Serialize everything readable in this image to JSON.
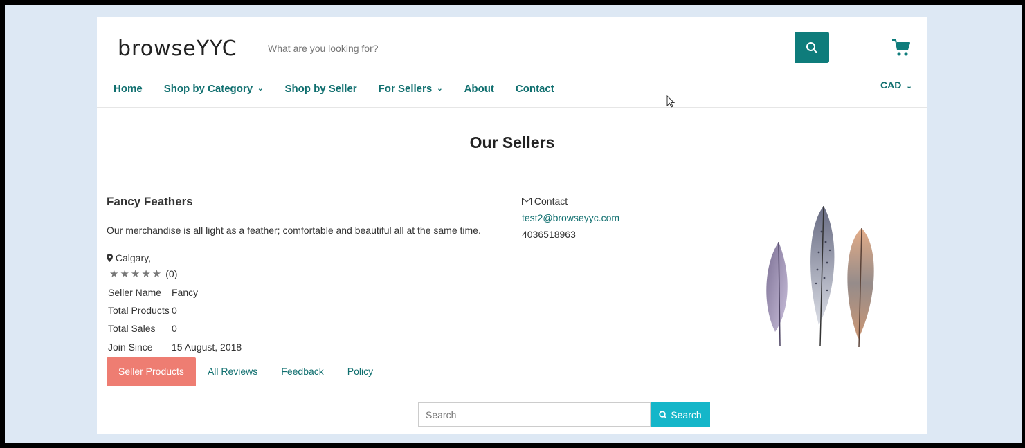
{
  "header": {
    "logo": "browseYYC",
    "search_placeholder": "What are you looking for?",
    "currency": "CAD"
  },
  "nav": {
    "items": [
      {
        "label": "Home",
        "dropdown": false
      },
      {
        "label": "Shop by Category",
        "dropdown": true
      },
      {
        "label": "Shop by Seller",
        "dropdown": false
      },
      {
        "label": "For Sellers",
        "dropdown": true
      },
      {
        "label": "About",
        "dropdown": false
      },
      {
        "label": "Contact",
        "dropdown": false
      }
    ]
  },
  "page": {
    "title": "Our Sellers"
  },
  "seller": {
    "name": "Fancy Feathers",
    "description": "Our merchandise is all light as a feather; comfortable and beautiful all at the same time.",
    "location": "Calgary,",
    "stars": "★★★★★",
    "rating_count": "(0)",
    "info": [
      {
        "key": "Seller Name",
        "value": "Fancy"
      },
      {
        "key": "Total Products",
        "value": "0"
      },
      {
        "key": "Total Sales",
        "value": "0"
      },
      {
        "key": "Join Since",
        "value": "15 August, 2018"
      }
    ],
    "contact_label": "Contact",
    "email": "test2@browseyyc.com",
    "phone": "4036518963"
  },
  "tabs": [
    {
      "label": "Seller Products",
      "active": true
    },
    {
      "label": "All Reviews",
      "active": false
    },
    {
      "label": "Feedback",
      "active": false
    },
    {
      "label": "Policy",
      "active": false
    }
  ],
  "product_search": {
    "placeholder": "Search",
    "button_label": "Search"
  },
  "colors": {
    "brand": "#0e7c7b",
    "tab_active": "#ee7d72",
    "search_button": "#15b6c9"
  }
}
